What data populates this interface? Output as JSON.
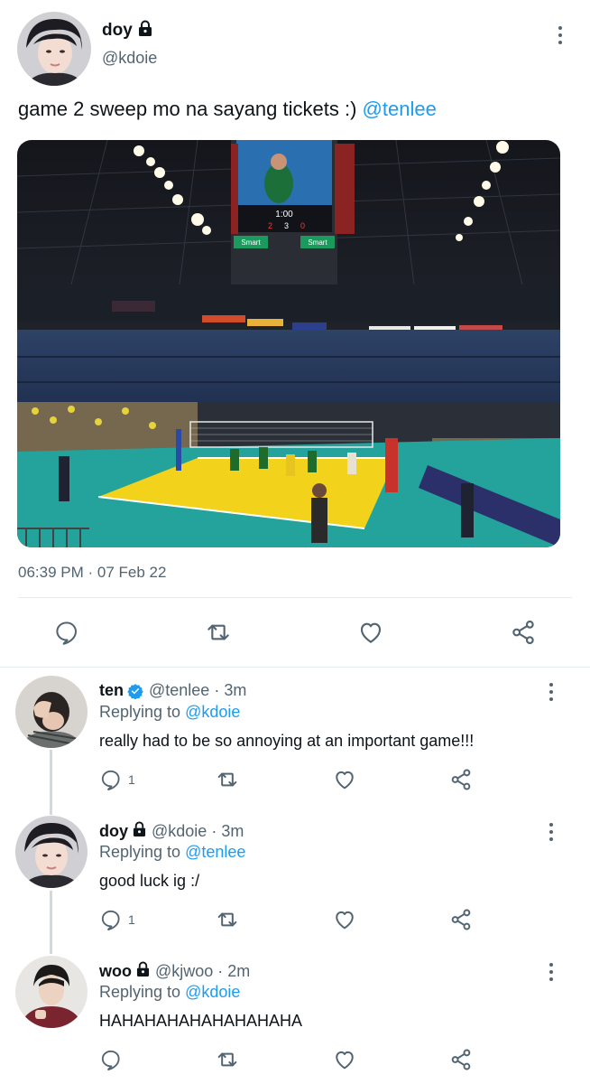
{
  "main_tweet": {
    "display_name": "doy",
    "handle": "@kdoie",
    "text": "game 2 sweep mo na sayang tickets :)",
    "mention": "@tenlee",
    "timestamp": "06:39 PM · 07 Feb 22",
    "scoreboard_time": "1:00",
    "scoreboard_sponsor": "Smart"
  },
  "replies": [
    {
      "display_name": "ten",
      "handle": "@tenlee",
      "time": "· 3m",
      "replying_prefix": "Replying to",
      "replying_to": "@kdoie",
      "text": "really had to be so annoying at an important game!!!",
      "reply_count": "1"
    },
    {
      "display_name": "doy",
      "handle": "@kdoie",
      "time": "· 3m",
      "replying_prefix": "Replying to",
      "replying_to": "@tenlee",
      "text": "good luck ig :/",
      "reply_count": "1"
    },
    {
      "display_name": "woo",
      "handle": "@kjwoo",
      "time": "· 2m",
      "replying_prefix": "Replying to",
      "replying_to": "@kdoie",
      "text": "HAHAHAHAHAHAHAHAHA",
      "reply_count": ""
    }
  ],
  "colors": {
    "accent": "#1d9bf0",
    "verified": "#1d9bf0",
    "muted": "#536471",
    "court_yellow": "#f2d21b",
    "court_teal": "#20a6a0"
  },
  "icons": [
    "lock-icon",
    "more-icon",
    "reply-icon",
    "retweet-icon",
    "like-icon",
    "share-icon",
    "verified-icon"
  ]
}
